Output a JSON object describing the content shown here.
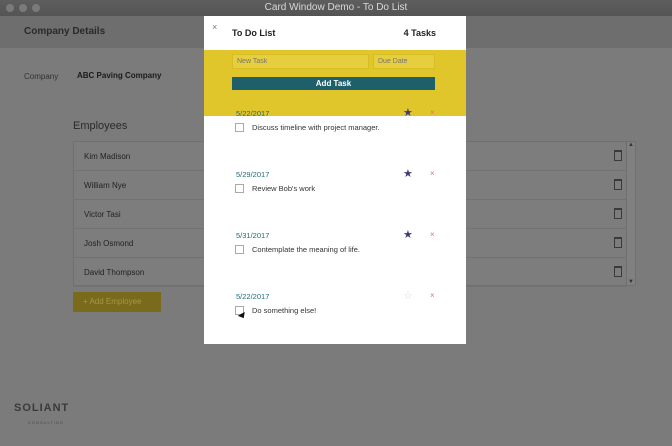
{
  "window": {
    "title": "Card Window Demo - To Do List"
  },
  "background": {
    "header": "Company Details",
    "company_label": "Company",
    "company_value": "ABC Paving Company",
    "employees_title": "Employees",
    "employees": [
      "Kim Madison",
      "William Nye",
      "Victor Tasi",
      "Josh Osmond",
      "David Thompson"
    ],
    "add_employee": "+ Add Employee",
    "logo": "SOLIANT",
    "logo_sub": "CONSULTING"
  },
  "modal": {
    "close": "×",
    "title": "To Do List",
    "count": "4 Tasks",
    "new_task_placeholder": "New Task",
    "due_date_placeholder": "Due Date",
    "add_task": "Add Task",
    "tasks": [
      {
        "date": "5/22/2017",
        "text": "Discuss timeline with project manager.",
        "starred": true
      },
      {
        "date": "5/29/2017",
        "text": "Review Bob's work",
        "starred": true
      },
      {
        "date": "5/31/2017",
        "text": "Contemplate the meaning of life.",
        "starred": true
      },
      {
        "date": "5/22/2017",
        "text": "Do something else!",
        "starred": false
      }
    ],
    "star_icon": "★",
    "delete_icon": "×"
  }
}
